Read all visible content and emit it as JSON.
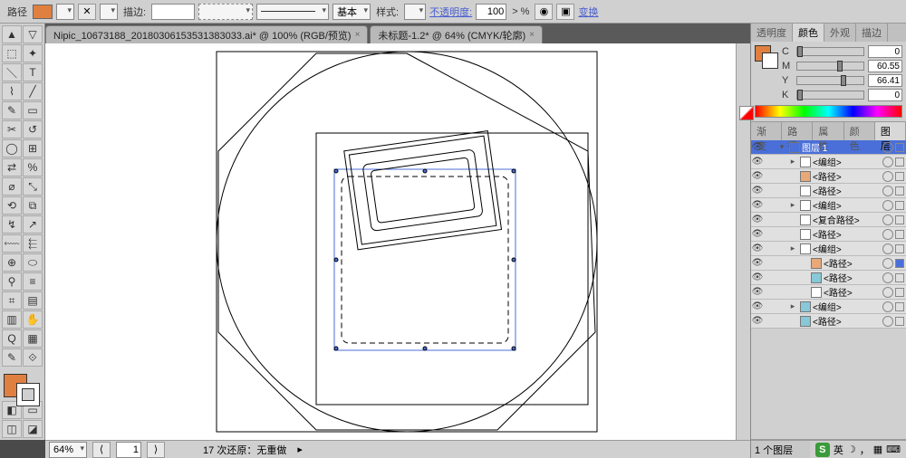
{
  "controlbar": {
    "mode_label": "路径",
    "no_stroke_icon": "✕",
    "stroke_label": "描边:",
    "stroke_weight": "",
    "stroke_dd": "",
    "dash_dd": "",
    "profile_label": "基本",
    "style_label": "样式:",
    "opacity_label": "不透明度:",
    "opacity_value": "100",
    "opacity_unit": "> %",
    "transform_link": "变换"
  },
  "tabs": [
    {
      "label": "Nipic_10673188_20180306153531383033.ai* @ 100% (RGB/预览)"
    },
    {
      "label": "未标题-1.2* @ 64% (CMYK/轮廓)"
    }
  ],
  "status": {
    "zoom": "64%",
    "page": "1",
    "history": "17 次还原：无重做"
  },
  "color_panel": {
    "tabs": [
      "透明度",
      "颜色",
      "外观",
      "描边"
    ],
    "active": 1,
    "channels": [
      {
        "ch": "C",
        "val": "0",
        "pos": 0
      },
      {
        "ch": "M",
        "val": "60.55",
        "pos": 60
      },
      {
        "ch": "Y",
        "val": "66.41",
        "pos": 66
      },
      {
        "ch": "K",
        "val": "0",
        "pos": 0
      }
    ]
  },
  "layers_panel": {
    "tabs": [
      "渐变",
      "路径",
      "属性",
      "颜色",
      "图层"
    ],
    "active": 4,
    "rows": [
      {
        "indent": 0,
        "disclose": "▾",
        "swatch": "#4a6fd8",
        "name": "图层 1",
        "sel": true
      },
      {
        "indent": 1,
        "disclose": "▸",
        "swatch": "#ffffff",
        "name": "<编组>"
      },
      {
        "indent": 1,
        "disclose": "",
        "swatch": "#e8a878",
        "name": "<路径>"
      },
      {
        "indent": 1,
        "disclose": "",
        "swatch": "#ffffff",
        "name": "<路径>"
      },
      {
        "indent": 1,
        "disclose": "▸",
        "swatch": "#ffffff",
        "name": "<编组>"
      },
      {
        "indent": 1,
        "disclose": "",
        "swatch": "#ffffff",
        "name": "<复合路径>"
      },
      {
        "indent": 1,
        "disclose": "",
        "swatch": "#ffffff",
        "name": "<路径>"
      },
      {
        "indent": 1,
        "disclose": "▸",
        "swatch": "#ffffff",
        "name": "<编组>"
      },
      {
        "indent": 2,
        "disclose": "",
        "swatch": "#e8a878",
        "name": "<路径>",
        "selmark": true
      },
      {
        "indent": 2,
        "disclose": "",
        "swatch": "#88c8d8",
        "name": "<路径>"
      },
      {
        "indent": 2,
        "disclose": "",
        "swatch": "#ffffff",
        "name": "<路径>"
      },
      {
        "indent": 1,
        "disclose": "▸",
        "swatch": "#88c8d8",
        "name": "<编组>"
      },
      {
        "indent": 1,
        "disclose": "",
        "swatch": "#88c8d8",
        "name": "<路径>"
      }
    ],
    "footer": "1 个图层"
  },
  "tray": {
    "ime": "S",
    "lang": "英",
    "icons": [
      "☽",
      "，",
      "▦",
      "⌨"
    ]
  }
}
